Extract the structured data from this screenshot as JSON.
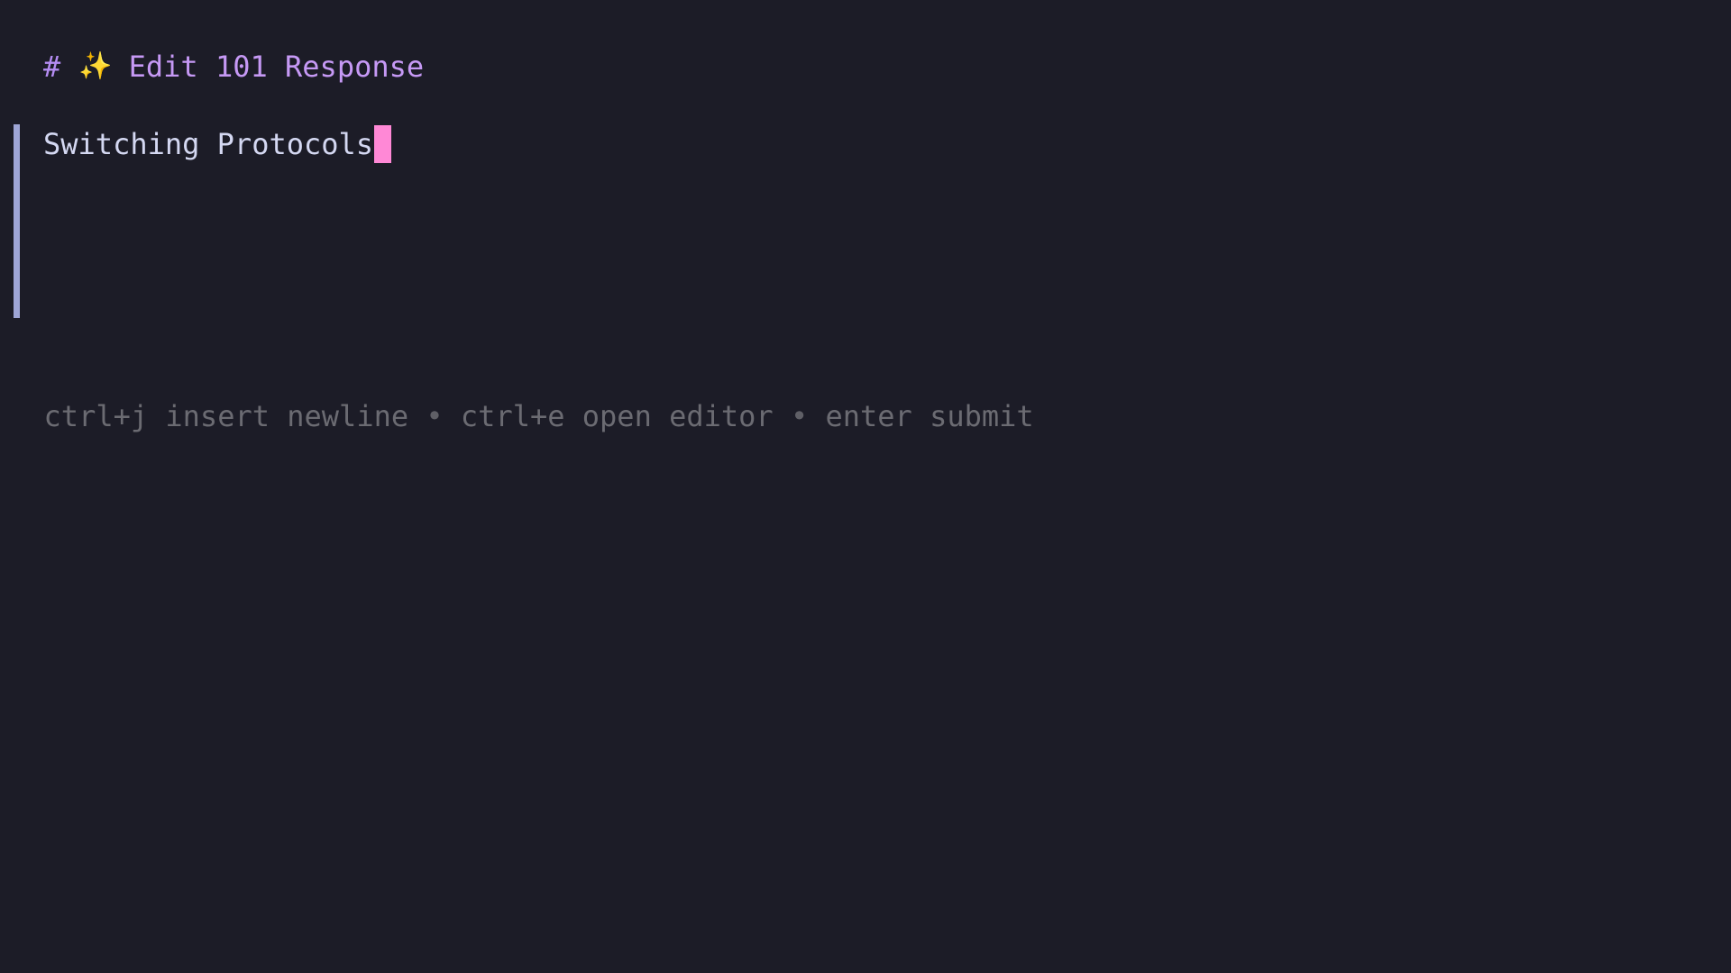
{
  "colors": {
    "background": "#1c1c27",
    "title": "#c699f5",
    "sparkle": "#f5c542",
    "input_text": "#d4d8f2",
    "input_border": "#9ea5d6",
    "cursor": "#ff88d6",
    "help_text": "#6b6b72"
  },
  "title": {
    "hash": "#",
    "icon": "sparkles-icon",
    "icon_glyph": "✨",
    "text": "Edit 101 Response"
  },
  "input": {
    "value": "Switching Protocols"
  },
  "help": {
    "items": [
      {
        "key": "ctrl+j",
        "action": "insert newline"
      },
      {
        "key": "ctrl+e",
        "action": "open editor"
      },
      {
        "key": "enter",
        "action": "submit"
      }
    ],
    "separator": "•"
  }
}
